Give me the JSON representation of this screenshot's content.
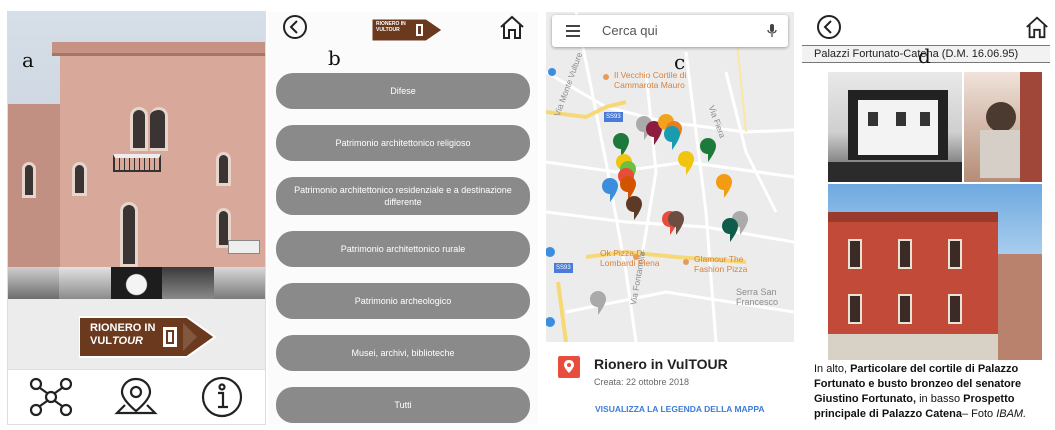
{
  "labels": {
    "a": "a",
    "b": "b",
    "c": "c",
    "d": "d"
  },
  "panel_a": {
    "logo_line1": "RIONERO IN",
    "logo_line2_prefix": "VUL",
    "logo_line2_italic": "TOUR",
    "nav_icons": [
      "network-icon",
      "map-pin-icon",
      "info-icon"
    ]
  },
  "panel_b": {
    "small_logo_line1": "RIONERO IN",
    "small_logo_line2": "VULTOUR",
    "menu": [
      "Difese",
      "Patrimonio architettonico religioso",
      "Patrimonio architettonico residenziale e a destinazione differente",
      "Patrimonio architettonico rurale",
      "Patrimonio archeologico",
      "Musei, archivi, biblioteche",
      "Tutti"
    ]
  },
  "panel_c": {
    "search_placeholder": "Cerca qui",
    "map_labels": {
      "cortile": "Il Vecchio Cortile di Cammarota Mauro",
      "via_monte": "Via Monte Vulture",
      "via_fiera": "Via Fiera",
      "ss93a": "SS93",
      "ss93b": "SS93",
      "pizza": "Ok Pizza Di Lombardi Elena",
      "glamour": "Glamour The Fashion Pizza",
      "serra": "Serra San Francesco",
      "via_fontanelle": "Via Fontanelle"
    },
    "card_title": "Rionero in VulTOUR",
    "card_date": "Creata: 22 ottobre 2018",
    "card_link": "VISUALIZZA LA LEGENDA DELLA MAPPA",
    "colors": {
      "accent": "#3b7dd8",
      "pin_red": "#e84c3d"
    }
  },
  "panel_d": {
    "subtitle": "Palazzi Fortunato-Catena (D.M. 16.06.95)",
    "caption": {
      "t1": "In alto, ",
      "b1": "Particolare del cortile di Palazzo Fortunato e busto bronzeo del senatore Giustino Fortunato,",
      "t2": " in basso ",
      "b2": "Prospetto principale di Palazzo Catena",
      "t3": "– Foto ",
      "i1": "IBAM."
    }
  }
}
